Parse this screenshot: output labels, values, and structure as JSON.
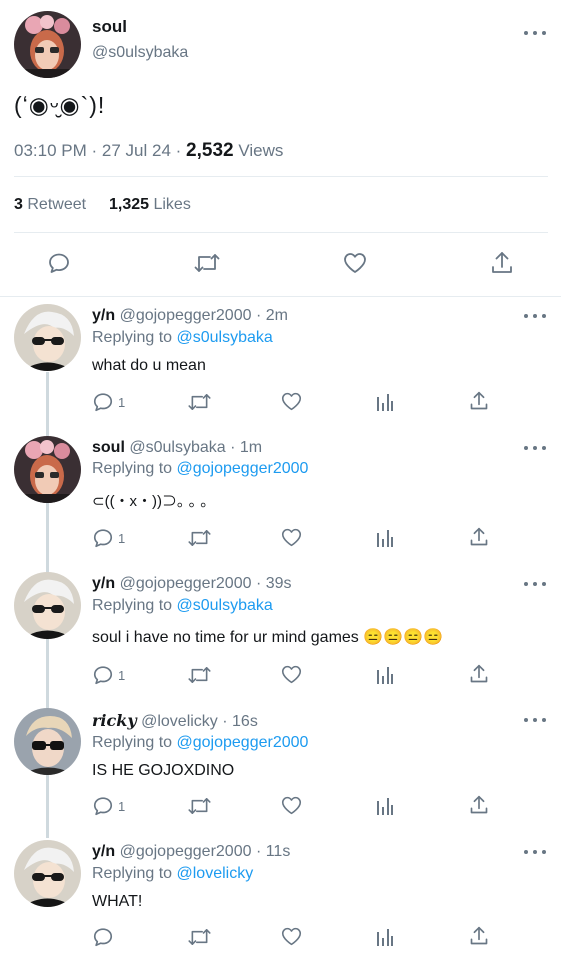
{
  "tweet": {
    "display_name": "soul",
    "handle": "@s0ulsybaka",
    "text": "(ʻ◉ᵕ̮◉`)!",
    "time": "03:10 PM",
    "sep1": "·",
    "date": "27 Jul 24",
    "sep2": "·",
    "views_count": "2,532",
    "views_label": "Views",
    "retweet_count": "3",
    "retweet_label": "Retweet",
    "likes_count": "1,325",
    "likes_label": "Likes"
  },
  "replies": [
    {
      "name": "y/n",
      "handle": "@gojopegger2000",
      "time": "· 2m",
      "replying_prefix": "Replying to",
      "replying_to": "@s0ulsybaka",
      "text": "what do u mean",
      "reply_count": "1"
    },
    {
      "name": "soul",
      "handle": "@s0ulsybaka",
      "time": "· 1m",
      "replying_prefix": "Replying to",
      "replying_to": "@gojopegger2000",
      "text": "⊂((・x・))⊃｡ ｡ ｡",
      "reply_count": "1"
    },
    {
      "name": "y/n",
      "handle": "@gojopegger2000",
      "time": "· 39s",
      "replying_prefix": "Replying to",
      "replying_to": "@s0ulsybaka",
      "text": "soul i have no time for ur mind games 😑😑😑😑",
      "reply_count": "1"
    },
    {
      "name": "ricky",
      "handle": "@lovelicky",
      "time": "· 16s",
      "replying_prefix": "Replying to",
      "replying_to": "@gojopegger2000",
      "text": "IS HE GOJOXDINO",
      "reply_count": "1"
    },
    {
      "name": "y/n",
      "handle": "@gojopegger2000",
      "time": "· 11s",
      "replying_prefix": "Replying to",
      "replying_to": "@lovelicky",
      "text": "WHAT!",
      "reply_count": ""
    }
  ],
  "icons": {
    "reply": "reply-icon",
    "retweet": "retweet-icon",
    "like": "heart-icon",
    "stats": "analytics-icon",
    "share": "share-icon",
    "more": "more-icon"
  },
  "colors": {
    "link": "#1d9bf0",
    "muted": "#687684",
    "divider": "#e6ecf0"
  }
}
